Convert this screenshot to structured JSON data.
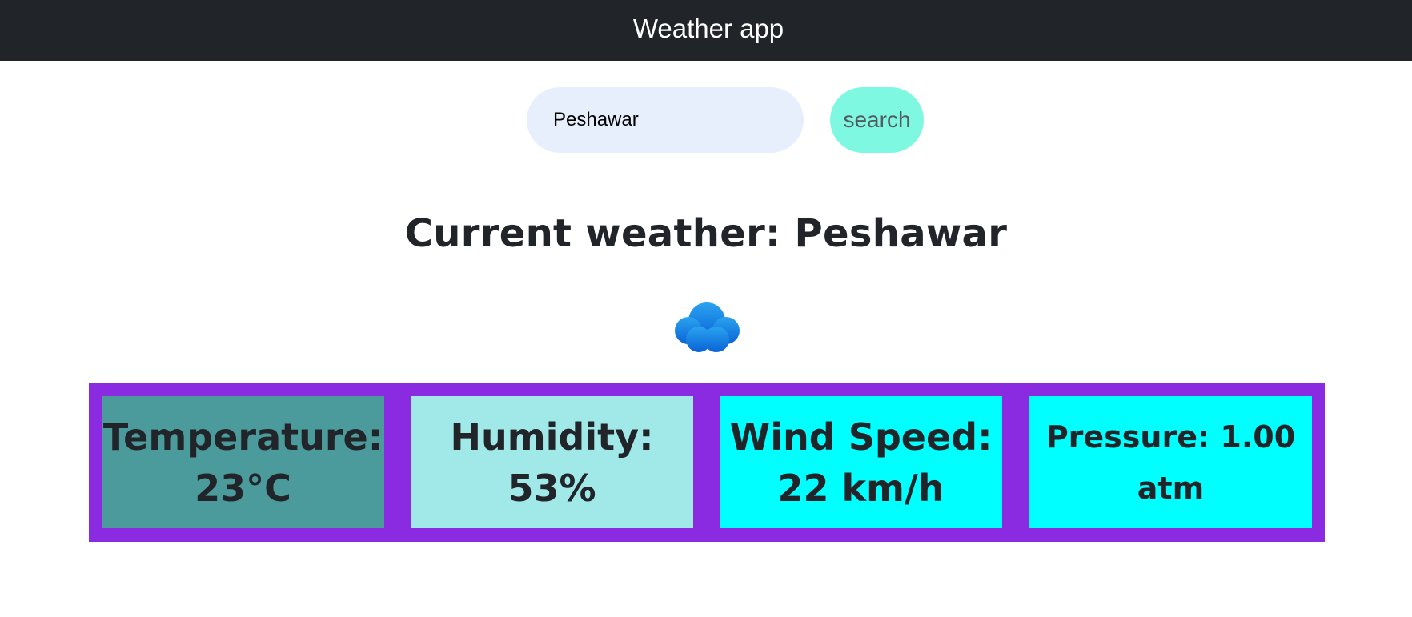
{
  "navbar": {
    "title": "Weather app"
  },
  "search": {
    "value": "Peshawar",
    "button_label": "search"
  },
  "main": {
    "heading": "Current weather: Peshawar",
    "icon": "cloud-icon"
  },
  "stats": {
    "temperature": {
      "line1": "Temperature:",
      "line2": "23°C",
      "color": "#4b9b9c"
    },
    "humidity": {
      "line1": "Humidity:",
      "line2": "53%",
      "color": "#a1e8e9"
    },
    "wind": {
      "line1": "Wind Speed:",
      "line2": "22 km/h",
      "color": "#00ffff"
    },
    "pressure": {
      "line1": "Pressure: 1.00",
      "line2": "atm",
      "color": "#00ffff"
    },
    "container_color": "#8a2be2"
  },
  "colors": {
    "navbar_bg": "#212529",
    "search_bg": "#e8effc",
    "button_bg": "#7ff8e2"
  }
}
